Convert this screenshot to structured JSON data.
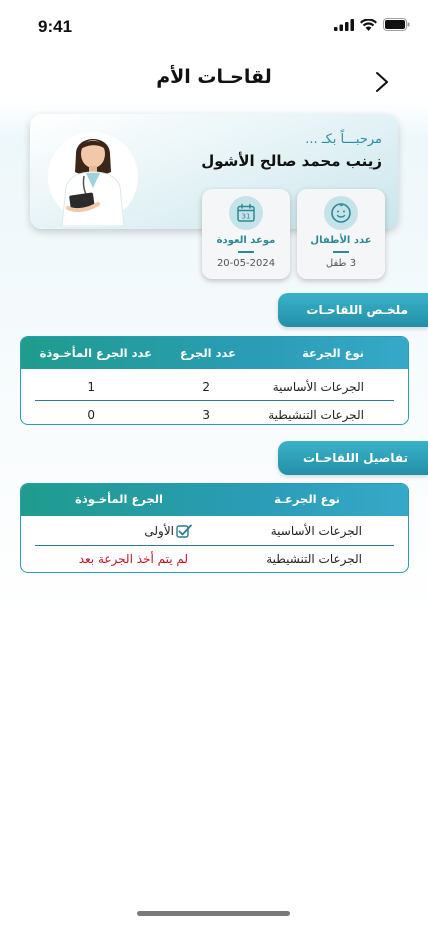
{
  "status_bar": {
    "time": "9:41"
  },
  "nav": {
    "title": "لقاحـات الأم"
  },
  "profile": {
    "greeting": "مرحبـــاً بكـ ...",
    "name": "زينب محمد صالح الأشول"
  },
  "stats": {
    "children": {
      "label": "عدد الأطفال",
      "value": "3 طفل",
      "icon": "baby-face-icon"
    },
    "return_date": {
      "label": "موعد العودة",
      "value": "20-05-2024",
      "icon": "calendar-icon"
    }
  },
  "summary": {
    "title": "ملخـص اللقاحـات",
    "headers": [
      "نوع الجرعة",
      "عدد الجرع",
      "عدد الجرع المأخـوذة"
    ],
    "rows": [
      {
        "type": "الجرعات الأساسية",
        "count": "2",
        "taken": "1"
      },
      {
        "type": "الجرعات التنشيطية",
        "count": "3",
        "taken": "0"
      }
    ]
  },
  "details": {
    "title": "تفاصيل اللقاحـات",
    "headers": [
      "نوع الجرعـة",
      "الجرع المأخـوذة"
    ],
    "rows": [
      {
        "type": "الجرعات الأساسية",
        "taken": "الأولى"
      },
      {
        "type": "الجرعات التنشيطية",
        "taken": "لم يتم أخذ الجرعة بعد"
      }
    ]
  },
  "colors": {
    "accent": "#2a9db3",
    "teal": "#1f9c8d",
    "warning": "#c1121f"
  }
}
